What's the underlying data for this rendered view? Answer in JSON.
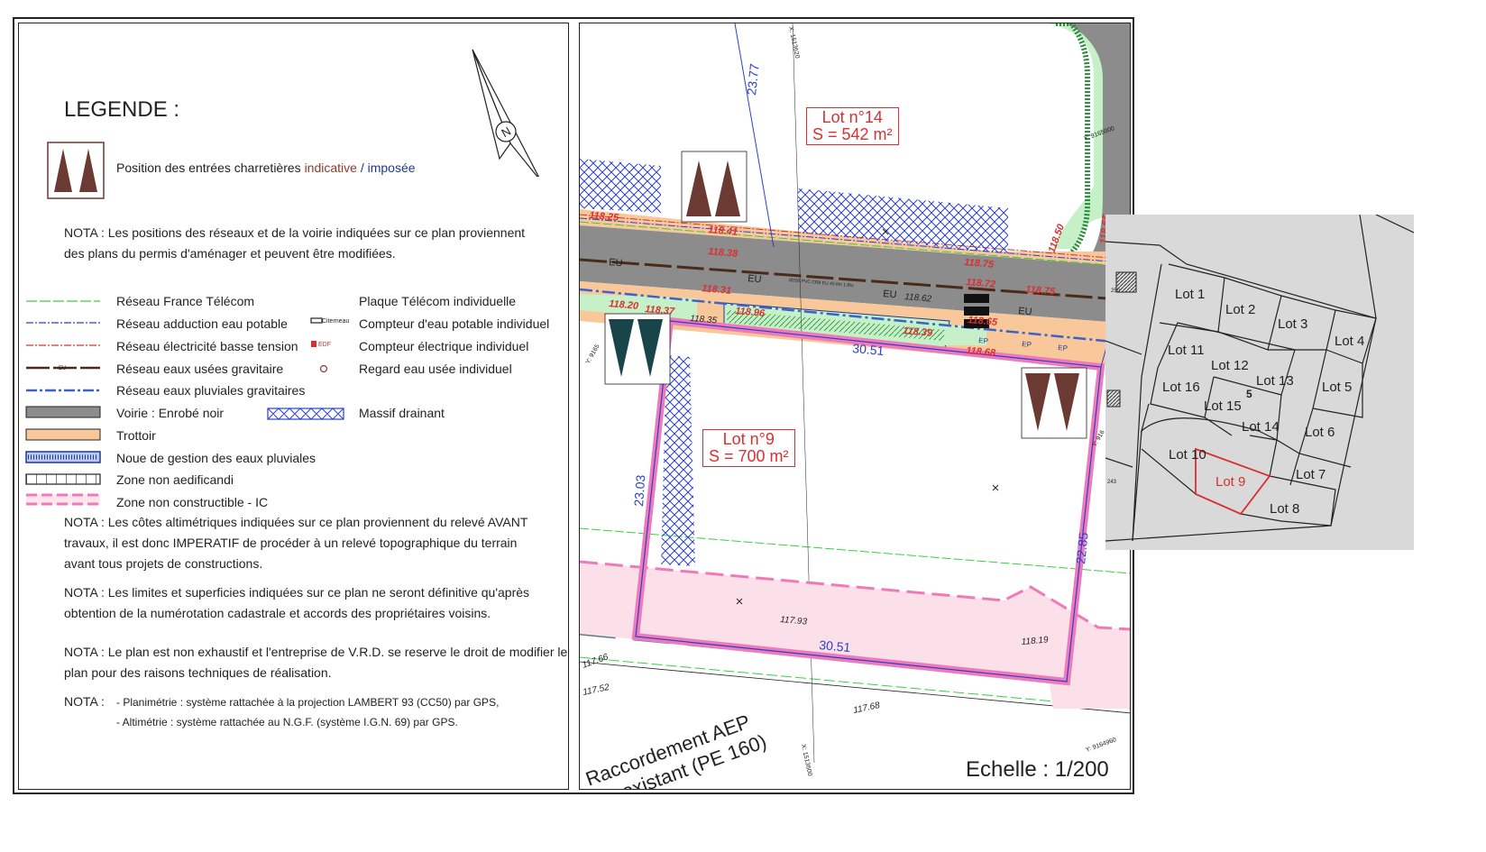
{
  "legend": {
    "title": "LEGENDE :",
    "entree": {
      "prefix": "Position des entrées charretières",
      "indicative": "indicative",
      "sep": "/",
      "imposee": "imposée"
    },
    "north_label": "N",
    "nota1_line1": "NOTA : Les positions des réseaux et de la voirie indiquées sur ce plan proviennent",
    "nota1_line2": "des plans du permis d'aménager et peuvent être modifiées.",
    "items_left": [
      "Réseau France Télécom",
      "Réseau adduction eau potable",
      "Réseau électricité basse tension",
      "Réseau eaux usées gravitaire",
      "Réseau eaux pluviales gravitaires",
      "Voirie : Enrobé noir",
      "Trottoir",
      "Noue de gestion des eaux pluviales",
      "Zone non aedificandi",
      "Zone non constructible - IC"
    ],
    "items_right": [
      "Plaque Télécom individuelle",
      "Compteur d'eau potable individuel",
      "Compteur électrique individuel",
      "Regard eau usée individuel",
      "Massif drainant"
    ],
    "sym_eu": "EU",
    "sym_citerneau": "Citerneau",
    "sym_edf": "EDF",
    "nota2": [
      "NOTA : Les côtes altimétriques indiquées sur ce plan proviennent du relevé AVANT",
      "travaux, il est donc IMPERATIF de procéder à un relevé topographique du terrain",
      "avant tous projets de constructions."
    ],
    "nota3": [
      "NOTA : Les limites et superficies indiquées sur ce plan ne seront définitive qu'après",
      "obtention de la numérotation cadastrale et accords des propriétaires voisins."
    ],
    "nota4": [
      "NOTA : Le plan est non exhaustif et l'entreprise de V.R.D. se reserve le droit de modifier le",
      " plan pour des raisons techniques de réalisation."
    ],
    "nota5_label": "NOTA :",
    "nota5": [
      "- Planimétrie : système rattachée à la projection LAMBERT 93 (CC50) par GPS,",
      "- Altimétrie : système rattachée au N.G.F. (système I.G.N. 69) par GPS."
    ]
  },
  "plan": {
    "lot14": {
      "name": "Lot n°14",
      "area": "S = 542 m²"
    },
    "lot9": {
      "name": "Lot n°9",
      "area": "S = 700 m²"
    },
    "dims": [
      "23.77",
      "30.51",
      "23.03",
      "22.85",
      "30.51"
    ],
    "levels_red": [
      "118.25",
      "118.41",
      "118.38",
      "118.31",
      "118.20",
      "118.37",
      "118.96",
      "118.75",
      "118.72",
      "118.75",
      "118.65",
      "118.68",
      "118.39",
      "118.50",
      "118.65"
    ],
    "levels_black": [
      "118.35",
      "118.62",
      "117.93",
      "118.19",
      "117.66",
      "117.52",
      "117.68"
    ],
    "coords": [
      "X: 1513620",
      "Y: 9165000",
      "Y: 9165",
      "Y: 916",
      "X: 1513600",
      "Y: 9164960"
    ],
    "net_eu": "EU",
    "net_ep": "EP",
    "pipe_note": "Ø200 PVC CR8 EU 40.6m 1.8%",
    "raccordement": [
      "Raccordement AEP",
      "existant (PE 160)"
    ],
    "echelle": "Echelle : 1/200"
  },
  "locator": {
    "lots": [
      "Lot 1",
      "Lot 2",
      "Lot 3",
      "Lot 4",
      "Lot 11",
      "Lot 12",
      "Lot 13",
      "Lot 5",
      "Lot 16",
      "Lot 15",
      "Lot 14",
      "Lot 6",
      "Lot 10",
      "Lot 9",
      "Lot 7",
      "Lot 8"
    ],
    "parcels": [
      "250",
      "243"
    ],
    "mark": "5"
  },
  "colors": {
    "brown": "#6b3a33",
    "teal": "#18444a",
    "pink": "#f07ab8",
    "pink_fill": "#fbe0ea",
    "road": "#8c8c8c",
    "sidewalk": "#f8c89a",
    "green": "#c5f0c8",
    "blue": "#2a3fd0",
    "red": "#d93030"
  }
}
